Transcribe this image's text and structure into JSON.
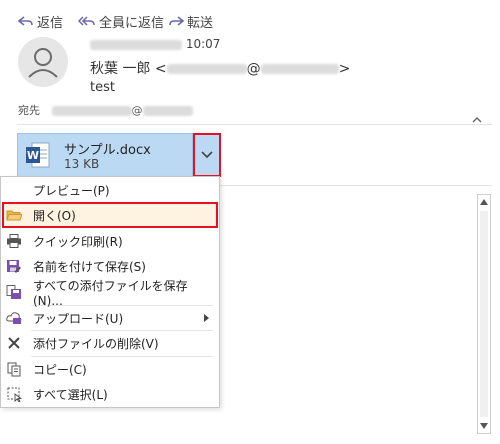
{
  "toolbar": {
    "reply": "返信",
    "reply_all": "全員に返信",
    "forward": "転送"
  },
  "header": {
    "date_time": "10:07",
    "sender_name": "秋葉 一郎",
    "sender_open": "<",
    "sender_at": "@",
    "sender_close": ">",
    "subject": "test",
    "to_label": "宛先",
    "to_at": "@"
  },
  "attachment": {
    "filename": "サンプル.docx",
    "size": "13 KB",
    "icon": "word-doc-icon"
  },
  "menu": {
    "items": [
      {
        "label": "プレビュー(P)",
        "icon": "none"
      },
      {
        "label": "開く(O)",
        "icon": "folder-open-icon"
      },
      {
        "label": "クイック印刷(R)",
        "icon": "printer-icon"
      },
      {
        "label": "名前を付けて保存(S)",
        "icon": "save-as-icon"
      },
      {
        "label": "すべての添付ファイルを保存(N)...",
        "icon": "save-all-icon"
      },
      {
        "label": "アップロード(U)",
        "icon": "upload-icon"
      },
      {
        "label": "添付ファイルの削除(V)",
        "icon": "delete-x-icon"
      },
      {
        "label": "コピー(C)",
        "icon": "copy-icon"
      },
      {
        "label": "すべて選択(L)",
        "icon": "select-all-icon"
      }
    ]
  },
  "colors": {
    "accent_red": "#e81123",
    "attachment_bg": "#bcd9f3",
    "highlight_bg": "#fef3e1"
  }
}
